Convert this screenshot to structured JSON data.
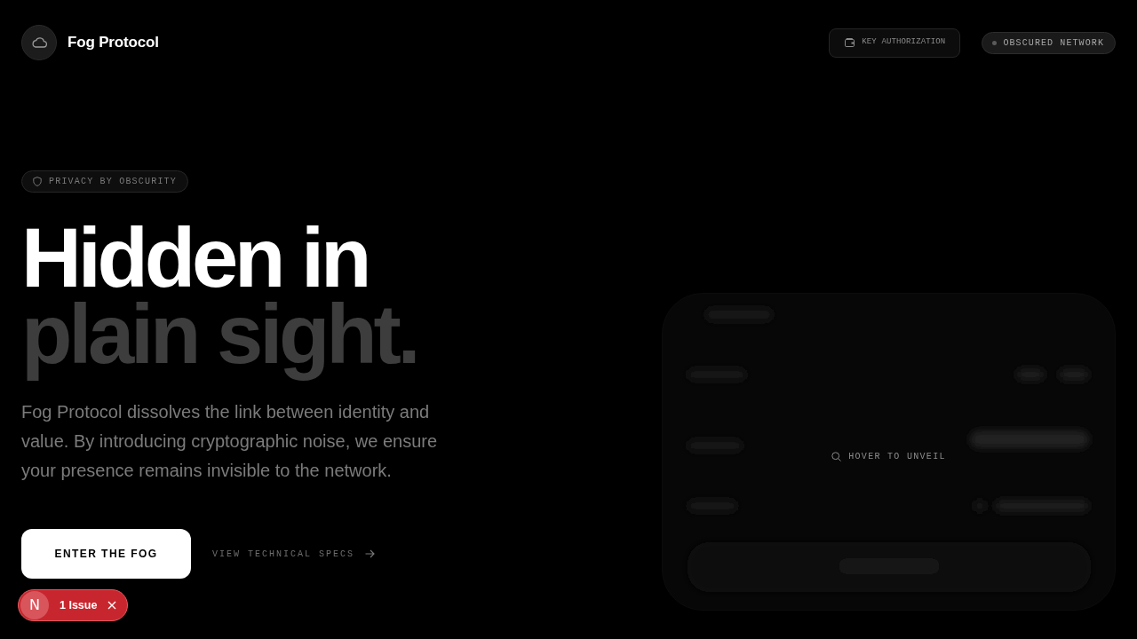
{
  "header": {
    "brand": "Fog Protocol",
    "key_button": "KEY AUTHORIZATION",
    "network_status": "OBSCURED NETWORK"
  },
  "hero": {
    "badge": "PRIVACY BY OBSCURITY",
    "headline": [
      {
        "text": "Hidden in",
        "color": "#ffffff"
      },
      {
        "text": "plain sight.",
        "color": "#3d3d3d"
      }
    ],
    "description": "Fog Protocol dissolves the link between identity and value. By introducing cryptographic noise, we ensure your presence remains invisible to the network.",
    "primary_button": "ENTER THE FOG",
    "secondary_link": "VIEW TECHNICAL SPECS"
  },
  "preview_card": {
    "hint": "HOVER TO UNVEIL"
  },
  "dev_indicator": {
    "logo_letter": "N",
    "label": "1 Issue"
  }
}
